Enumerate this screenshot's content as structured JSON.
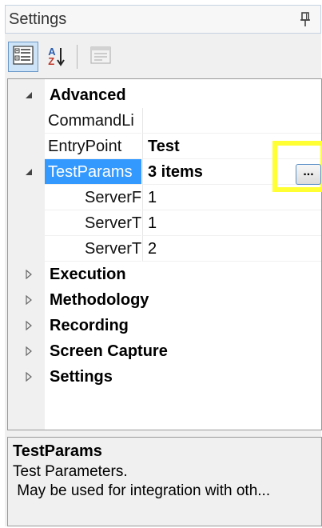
{
  "titlebar": {
    "title": "Settings",
    "pin_icon": "pin-icon"
  },
  "toolbar": {
    "buttons": [
      {
        "name": "categorized-view-button",
        "icon": "categorized-icon",
        "active": true
      },
      {
        "name": "alphabetical-sort-button",
        "icon": "sort-az-icon",
        "active": false
      },
      {
        "name": "property-pages-button",
        "icon": "property-pages-icon",
        "disabled": true
      }
    ],
    "sort_letters": {
      "a": "A",
      "z": "Z"
    }
  },
  "grid": {
    "advanced": {
      "label": "Advanced",
      "expanded": true
    },
    "properties": {
      "commandline": {
        "name": "CommandLi",
        "value": ""
      },
      "entrypoint": {
        "name": "EntryPoint",
        "value": "Test"
      },
      "testparams": {
        "name": "TestParams",
        "value": "3 items",
        "expanded": true,
        "ellipsis": "..."
      },
      "sub1": {
        "name": "ServerF",
        "value": "1"
      },
      "sub2": {
        "name": "ServerT",
        "value": "1"
      },
      "sub3": {
        "name": "ServerT",
        "value": "2"
      }
    },
    "categories": [
      {
        "label": "Execution"
      },
      {
        "label": "Methodology"
      },
      {
        "label": "Recording"
      },
      {
        "label": "Screen Capture"
      },
      {
        "label": "Settings"
      }
    ]
  },
  "description": {
    "title": "TestParams",
    "line1": "Test Parameters.",
    "line2": " May be used for integration with oth..."
  },
  "colors": {
    "selection": "#3399ff",
    "highlight": "#ffff33"
  }
}
